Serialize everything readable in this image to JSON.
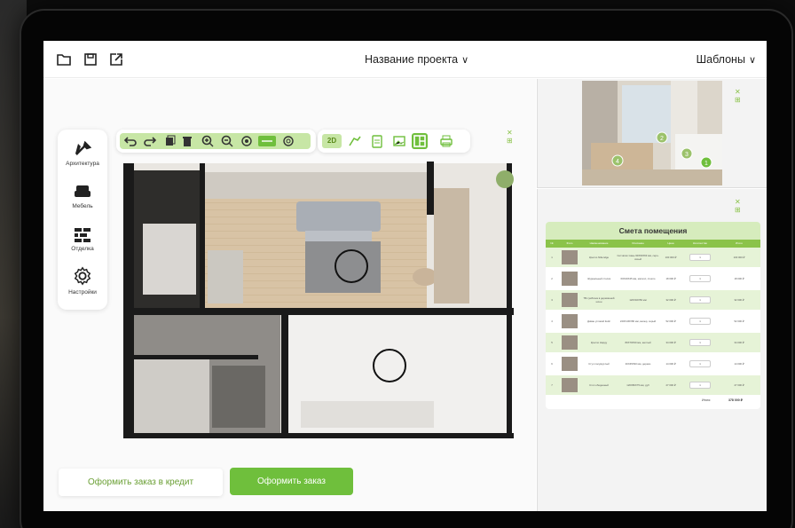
{
  "header": {
    "project_title": "Название проекта",
    "templates_label": "Шаблоны",
    "chevron": "∨"
  },
  "left_menu": [
    {
      "label": "Архитектура",
      "icon": "tools-icon"
    },
    {
      "label": "Мебель",
      "icon": "sofa-icon"
    },
    {
      "label": "Отделка",
      "icon": "brick-wall-icon"
    },
    {
      "label": "Настройки",
      "icon": "gear-icon"
    }
  ],
  "toolbar": {
    "mode_2d": "2D"
  },
  "buttons": {
    "credit_order": "Оформить заказ в кредит",
    "order": "Оформить заказ"
  },
  "photo_markers": [
    "2",
    "3",
    "4",
    "1"
  ],
  "estimate": {
    "title": "Смета помещения",
    "columns": [
      "№",
      "Фото",
      "Наименование",
      "Описание",
      "Цена",
      "Количество",
      "Итого"
    ],
    "rows": [
      {
        "n": "1",
        "name": "Кресло Nittendge",
        "desc": "Сетчатая ткань 90Х60Х93 мм, серо-сизый",
        "price": "100 000 ₽",
        "qty": "1",
        "total": "100 000 ₽"
      },
      {
        "n": "2",
        "name": "Журнальный столик",
        "desc": "60Х40Х45 мм, металл, стекло",
        "price": "18 000 ₽",
        "qty": "1",
        "total": "18 000 ₽"
      },
      {
        "n": "3",
        "name": "ТВ-тумбочка в деревянной шпон",
        "desc": "120Х40Х50 мм",
        "price": "32 000 ₽",
        "qty": "1",
        "total": "32 000 ₽"
      },
      {
        "n": "4",
        "name": "Диван угловой Кейс",
        "desc": "220Х130Х80 мм, велюр, серый",
        "price": "52 000 ₽",
        "qty": "1",
        "total": "52 000 ₽"
      },
      {
        "n": "5",
        "name": "Кресло Нарду",
        "desc": "80Х70Х90 мм, желтый",
        "price": "34 000 ₽",
        "qty": "1",
        "total": "34 000 ₽"
      },
      {
        "n": "6",
        "name": "Стул полукруглый",
        "desc": "40Х45Х90 мм, дерево",
        "price": "14 000 ₽",
        "qty": "1",
        "total": "14 000 ₽"
      },
      {
        "n": "7",
        "name": "Стол обеденный",
        "desc": "120Х80Х75 мм, дуб",
        "price": "27 000 ₽",
        "qty": "1",
        "total": "27 000 ₽"
      }
    ],
    "total_label": "Итого:",
    "total_value": "378 000 ₽"
  },
  "colors": {
    "accent": "#6fbf3c",
    "accent_light": "#c7e6a5",
    "header_green": "#8bc34a"
  }
}
